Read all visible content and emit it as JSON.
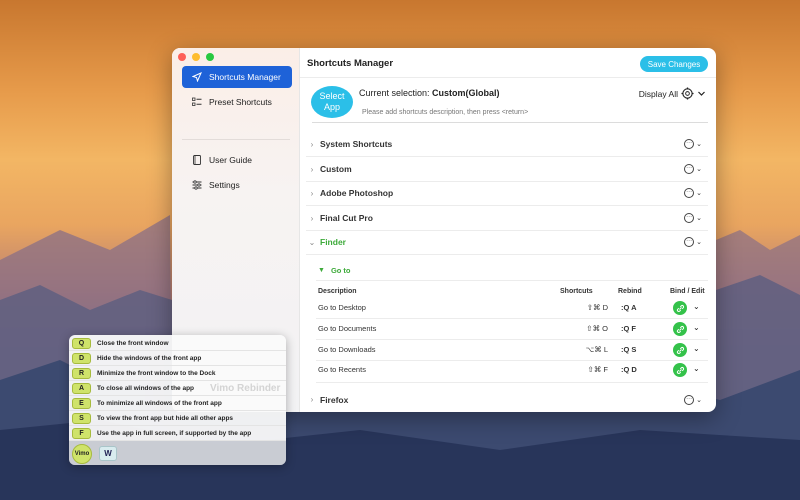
{
  "window": {
    "title": "Shortcuts Manager",
    "save_label": "Save Changes",
    "select_app_label_1": "Select",
    "select_app_label_2": "App",
    "current_selection_prefix": "Current selection: ",
    "current_selection_value": "Custom(Global)",
    "input_hint": "Please add shortcuts description, then press <return>",
    "display_all_label": "Display All"
  },
  "sidebar": {
    "items": [
      {
        "label": "Shortcuts Manager",
        "icon": "send-icon"
      },
      {
        "label": "Preset Shortcuts",
        "icon": "list-icon"
      },
      {
        "label": "User Guide",
        "icon": "book-icon"
      },
      {
        "label": "Settings",
        "icon": "sliders-icon"
      }
    ]
  },
  "categories": [
    {
      "label": "System Shortcuts",
      "expanded": false
    },
    {
      "label": "Custom",
      "expanded": false
    },
    {
      "label": "Adobe Photoshop",
      "expanded": false
    },
    {
      "label": "Final Cut Pro",
      "expanded": false
    },
    {
      "label": "Finder",
      "expanded": true
    },
    {
      "label": "Firefox",
      "expanded": false
    }
  ],
  "group": {
    "label": "Go to"
  },
  "table": {
    "headers": {
      "description": "Description",
      "shortcuts": "Shortcuts",
      "rebind": "Rebind",
      "bind_edit": "Bind / Edit"
    },
    "rows": [
      {
        "description": "Go to Desktop",
        "shortcut": "⇧⌘ D",
        "rebind": ":Q A"
      },
      {
        "description": "Go to Documents",
        "shortcut": "⇧⌘ O",
        "rebind": ":Q F"
      },
      {
        "description": "Go to Downloads",
        "shortcut": "⌥⌘ L",
        "rebind": ":Q S"
      },
      {
        "description": "Go to Recents",
        "shortcut": "⇧⌘ F",
        "rebind": ":Q D"
      }
    ]
  },
  "overlay": {
    "rows": [
      {
        "key": "Q",
        "text": "Close the front window"
      },
      {
        "key": "D",
        "text": "Hide the windows of the front app"
      },
      {
        "key": "R",
        "text": "Minimize the front window to the Dock"
      },
      {
        "key": "A",
        "text": "To close all windows of the app"
      },
      {
        "key": "E",
        "text": "To minimize all windows of the front app"
      },
      {
        "key": "S",
        "text": "To view the front app but hide all other apps"
      },
      {
        "key": "F",
        "text": "Use the app in full screen, if supported by the app"
      }
    ],
    "watermark": "Vimo Rebinder",
    "badge": "Vimo",
    "current_key": "W"
  },
  "colors": {
    "accent": "#2bbfe8",
    "sidebar_active": "#1e62d8",
    "green": "#34c24a",
    "key_bg": "#cfe36a"
  }
}
